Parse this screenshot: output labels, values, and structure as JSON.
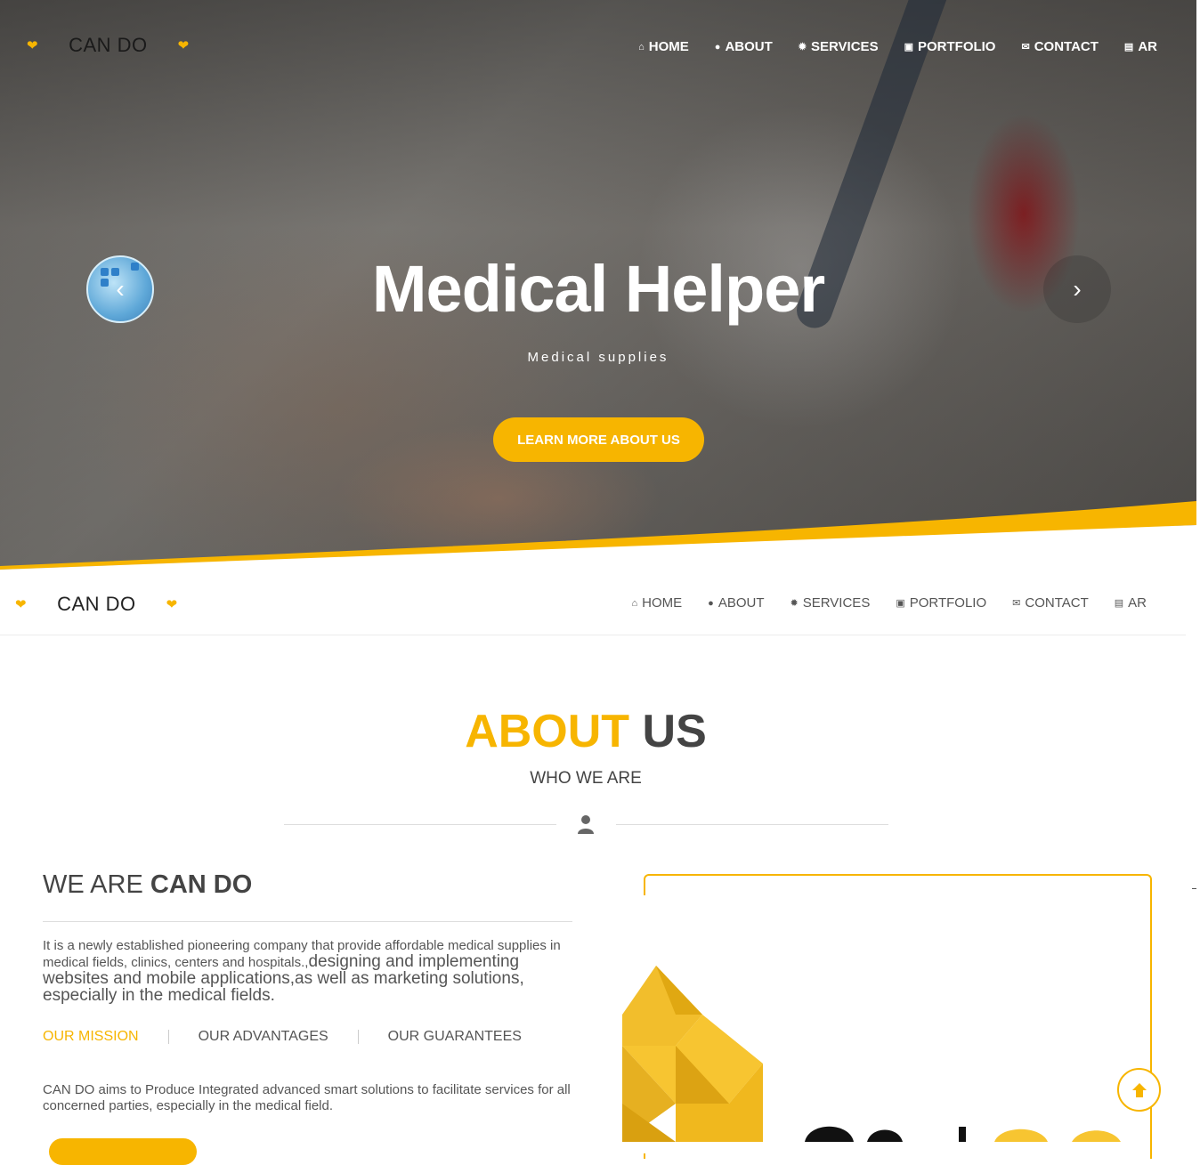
{
  "brand": {
    "name": "CAN DO",
    "heart_icon": "heart-icon",
    "accent_color": "#f7b500"
  },
  "nav": [
    {
      "label": "HOME",
      "icon": "home-icon"
    },
    {
      "label": "ABOUT",
      "icon": "user-icon"
    },
    {
      "label": "SERVICES",
      "icon": "gear-icon"
    },
    {
      "label": "PORTFOLIO",
      "icon": "image-icon"
    },
    {
      "label": "CONTACT",
      "icon": "envelope-icon"
    },
    {
      "label": "AR",
      "icon": "language-icon"
    }
  ],
  "hero": {
    "title": "Medical Helper",
    "subtitle": "Medical supplies",
    "button": "LEARN MORE ABOUT US",
    "prev_icon": "chevron-left-icon",
    "next_icon": "chevron-right-icon"
  },
  "about": {
    "title_highlight": "ABOUT",
    "title_rest": "US",
    "subtitle": "WHO WE ARE",
    "heading_light": "WE ARE",
    "heading_bold": "CAN DO",
    "description_small": "It is a newly established pioneering company that provide affordable medical supplies in medical fields, clinics, centers and hospitals.,",
    "description_large": "designing and implementing websites and mobile applications,as well as marketing solutions, especially in the medical fields.",
    "tabs": [
      "OUR MISSION",
      "OUR ADVANTAGES",
      "OUR GUARANTEES"
    ],
    "mission_text": "CAN DO aims to Produce Integrated advanced smart solutions to facilitate services for all concerned parties, especially in the medical field."
  },
  "scroll_top_icon": "arrow-up-icon"
}
